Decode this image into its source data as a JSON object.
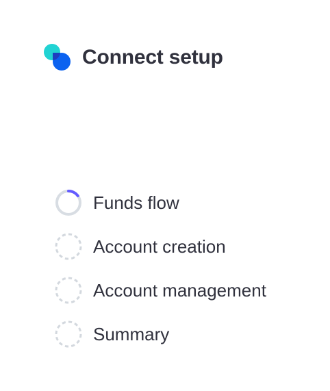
{
  "header": {
    "title": "Connect setup",
    "logo_icon": "connect-logo-icon"
  },
  "steps": [
    {
      "label": "Funds flow",
      "status": "in-progress",
      "progress": 0.15,
      "icon": "progress-ring-icon"
    },
    {
      "label": "Account creation",
      "status": "pending",
      "icon": "dashed-circle-icon"
    },
    {
      "label": "Account management",
      "status": "pending",
      "icon": "dashed-circle-icon"
    },
    {
      "label": "Summary",
      "status": "pending",
      "icon": "dashed-circle-icon"
    }
  ],
  "colors": {
    "text": "#30313d",
    "accent": "#635bff",
    "ring_track": "#d8dde3",
    "dashed": "#d3d8de",
    "logo_cyan": "#21d3d3",
    "logo_blue": "#0b62f0",
    "logo_overlap": "#1d3fbf"
  }
}
